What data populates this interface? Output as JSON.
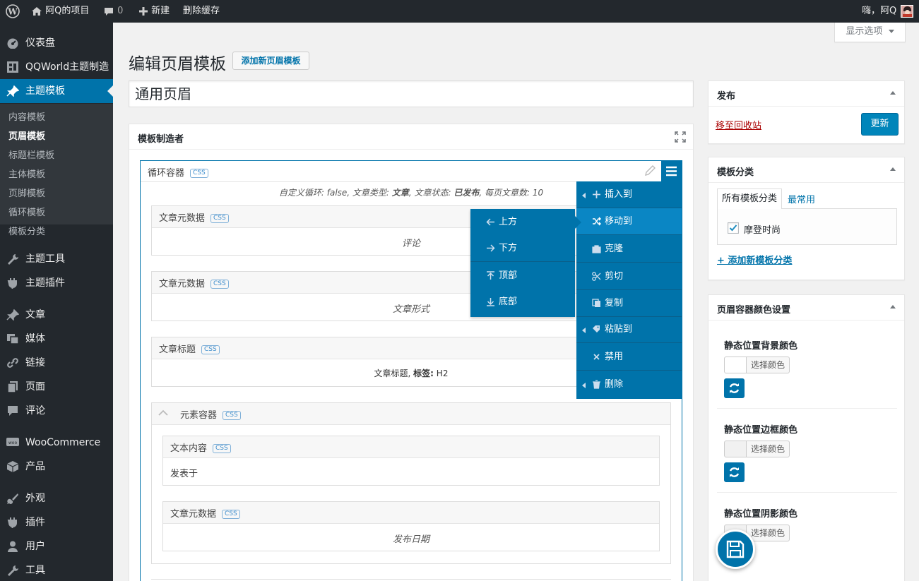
{
  "adminbar": {
    "site_name": "阿Q的项目",
    "comments_count": "0",
    "new_label": "新建",
    "clear_cache": "删除缓存",
    "greeting": "嗨，阿Q"
  },
  "sidebar": {
    "items": [
      {
        "label": "仪表盘"
      },
      {
        "label": "QQWorld主题制造"
      },
      {
        "label": "主题模板"
      },
      {
        "label": "主题工具"
      },
      {
        "label": "主题插件"
      },
      {
        "label": "文章"
      },
      {
        "label": "媒体"
      },
      {
        "label": "链接"
      },
      {
        "label": "页面"
      },
      {
        "label": "评论"
      },
      {
        "label": "WooCommerce"
      },
      {
        "label": "产品"
      },
      {
        "label": "外观"
      },
      {
        "label": "插件"
      },
      {
        "label": "用户"
      },
      {
        "label": "工具"
      }
    ],
    "submenu": [
      "内容模板",
      "页眉模板",
      "标题栏模板",
      "主体模板",
      "页脚模板",
      "循环模板",
      "模板分类"
    ]
  },
  "screen_options": "显示选项",
  "page": {
    "title": "编辑页眉模板",
    "add_new": "添加新页眉模板",
    "post_title": "通用页眉"
  },
  "builder": {
    "box_title": "模板制造者",
    "loop": {
      "title": "循环容器",
      "css": "CSS",
      "summary_pre": "自定义循环: false, 文章类型: ",
      "summary_type": "文章",
      "summary_mid": ", 文章状态: ",
      "summary_status": "已发布",
      "summary_post": ", 每页文章数: 10"
    },
    "blocks": [
      {
        "title": "文章元数据",
        "body": "评论"
      },
      {
        "title": "文章元数据",
        "body": "文章形式"
      },
      {
        "title": "文章标题",
        "body_pre": "文章标题, ",
        "body_bold": "标签:",
        "body_post": " H2"
      }
    ],
    "element_container": {
      "title": "元素容器",
      "text_block": {
        "title": "文本内容",
        "body": "发表于"
      },
      "meta_block": {
        "title": "文章元数据",
        "body": "发布日期"
      }
    }
  },
  "context_menu": {
    "items": [
      "插入到",
      "移动到",
      "克隆",
      "剪切",
      "复制",
      "粘贴到",
      "禁用",
      "删除"
    ],
    "submenu": [
      "上方",
      "下方",
      "顶部",
      "底部"
    ]
  },
  "publish": {
    "title": "发布",
    "trash": "移至回收站",
    "update": "更新"
  },
  "categories": {
    "title": "模板分类",
    "tab_all": "所有模板分类",
    "tab_popular": "最常用",
    "item": "摩登时尚",
    "add_new": "+ 添加新模板分类"
  },
  "colors": {
    "title": "页眉容器颜色设置",
    "rows": [
      {
        "label": "静态位置背景颜色",
        "button": "选择颜色"
      },
      {
        "label": "静态位置边框颜色",
        "button": "选择颜色"
      },
      {
        "label": "静态位置阴影颜色",
        "button": "选择颜色"
      }
    ]
  },
  "theme": {
    "accent": "#0073aa",
    "sidebar_bg": "#23282d",
    "submenu_bg": "#32373c",
    "link": "#0073aa",
    "trash_link": "#a00"
  }
}
